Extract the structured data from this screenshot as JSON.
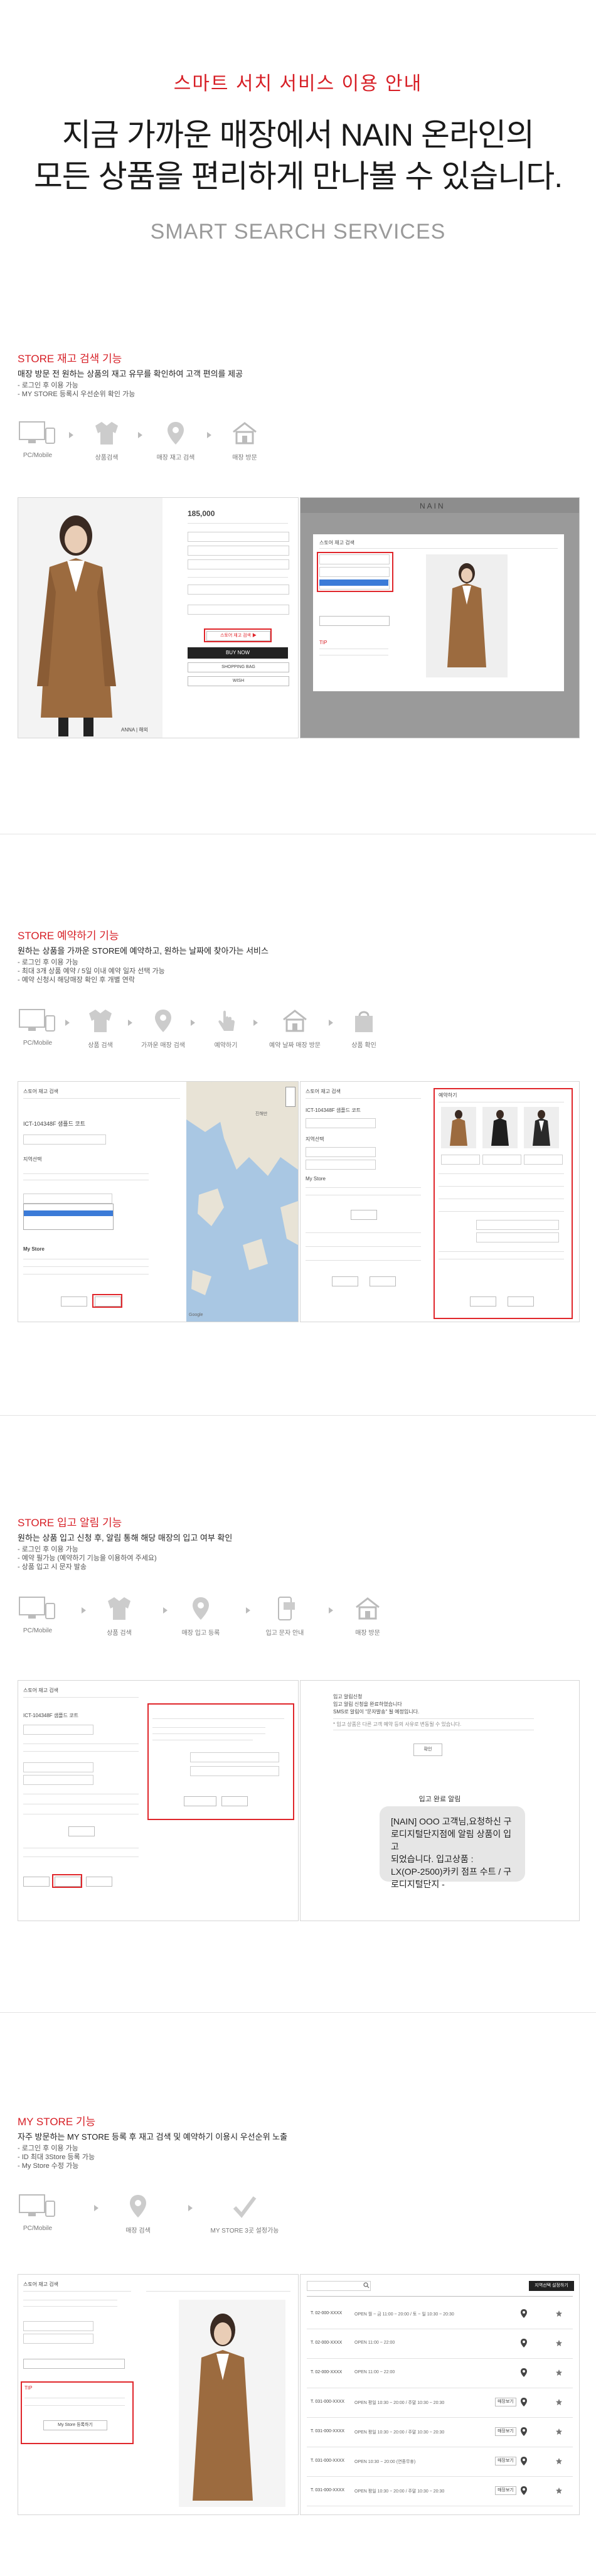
{
  "hero": {
    "title": "스마트 서치 서비스 이용 안내",
    "line1": "지금 가까운 매장에서 NAIN 온라인의",
    "line2": "모든 상품을 편리하게 만나볼 수 있습니다.",
    "subtitle": "SMART SEARCH SERVICES"
  },
  "section1": {
    "title": "STORE 재고 검색 기능",
    "desc": "매장 방문 전 원하는 상품의 재고 유무를 확인하여 고객 편의를 제공",
    "notes": [
      "- 로그인 후 이용 가능",
      "- MY STORE 등록시 우선순위 확인 가능"
    ],
    "steps": [
      "PC/Mobile",
      "상품검색",
      "매장 재고 검색",
      "매장 방문"
    ],
    "price": "185,000",
    "buy_now": "BUY NOW",
    "shopping_bag": "SHOPPING BAG",
    "wish": "WISH",
    "store_search": "스토어 재고 검색 ▶",
    "logo": "NAIN",
    "popup_title": "스토어 재고 검색",
    "tip": "TIP",
    "caption": "ANNA | 해외"
  },
  "section2": {
    "title": "STORE 예약하기 기능",
    "desc": "원하는 상품을 가까운 STORE에 예약하고, 원하는 날짜에 찾아가는 서비스",
    "notes": [
      "- 로그인 후 이용 가능",
      "- 최대 3개 상품 예약 / 5일 이내 예약 일자 선택 가능",
      "- 예약 신청시 해당매장 확인 후 개별 연락"
    ],
    "steps": [
      "PC/Mobile",
      "상품 검색",
      "가까운 매장 검색",
      "예약하기",
      "예약 날짜 매장 방문",
      "상품 확인"
    ],
    "popup_title": "스토어 재고 검색",
    "product_code": "ICT-104348F 샘플드 코트",
    "region_label": "지역선택",
    "my_store": "My Store",
    "reserve_title": "예약하기",
    "map_label": "Google",
    "place": "진해만"
  },
  "section3": {
    "title": "STORE 입고 알림 기능",
    "desc": "원하는 상품 입고 신청 후, 알림 통해 해당 매장의 입고 여부 확인",
    "notes": [
      "- 로그인 후 이용 가능",
      "- 예약 필가능 (예약하기 기능을 이용하여 주세요)",
      "- 상품 입고 시 문자 발송"
    ],
    "steps": [
      "PC/Mobile",
      "상품 검색",
      "매장 입고 등록",
      "입고 문자 안내",
      "매장 방문"
    ],
    "popup_title": "스토어 재고 검색",
    "product_code": "ICT-104348F 샘플드 코트",
    "notice_title": "입고 완료 알림",
    "confirm": "확인",
    "sms_lines": [
      "[NAIN] OOO 고객님,요청하신 구",
      "로디지털단지점에 알림 상품이 입고",
      "되었습니다. 입고상품 :",
      "LX(OP-2500)카키 점프 수트 / 구",
      "로디지털단지 -"
    ],
    "notice_lines": [
      "입고 알림신청",
      "입고 알림 신청을 완료하였습니다",
      "SMS로 알림이 \"문자발송\" 될 예정입니다.",
      "* 입고 상품은 다른 고객 예약 등의 사유로 변동될 수 있습니다."
    ]
  },
  "section4": {
    "title": "MY STORE 기능",
    "desc": "자주 방문하는 MY STORE 등록 후 재고 검색 및 예약하기 이용시 우선순위 노출",
    "notes": [
      "- 로그인 후 이용 가능",
      "- ID 최대 3Store 등록 가능",
      "- My Store 수정 가능"
    ],
    "steps": [
      "PC/Mobile",
      "매장 검색",
      "MY STORE 3곳 설정가능"
    ],
    "popup_title": "스토어 재고 검색",
    "tip": "TIP",
    "mystore_button": "My Store 등록하기",
    "tab_label": "지역선택 설정하기",
    "list_action": "매장보기",
    "store_rows": [
      {
        "phone": "T. 02-000-XXXX",
        "hours": "OPEN 월 ~ 금 11:00 ~ 20:00 / 토 ~ 일 10:30 ~ 20:30"
      },
      {
        "phone": "T. 02-000-XXXX",
        "hours": "OPEN 11:00 ~ 22:00"
      },
      {
        "phone": "T. 02-000-XXXX",
        "hours": "OPEN 11:00 ~ 22:00"
      },
      {
        "phone": "T. 031-000-XXXX",
        "hours": "OPEN 평일 10:30 ~ 20:00 / 주말 10:30 ~ 20:30"
      },
      {
        "phone": "T. 031-000-XXXX",
        "hours": "OPEN 평일 10:30 ~ 20:00 / 주말 10:30 ~ 20:30"
      },
      {
        "phone": "T. 031-000-XXXX",
        "hours": "OPEN 10:30 ~ 20:00 (연중무휴)"
      },
      {
        "phone": "T. 031-000-XXXX",
        "hours": "OPEN 평일 10:30 ~ 20:00 / 주말 10:30 ~ 20:30"
      }
    ]
  },
  "colors": {
    "accent": "#d71f26",
    "coat": "#9c6b3f",
    "map_sea": "#a9c7e3"
  }
}
